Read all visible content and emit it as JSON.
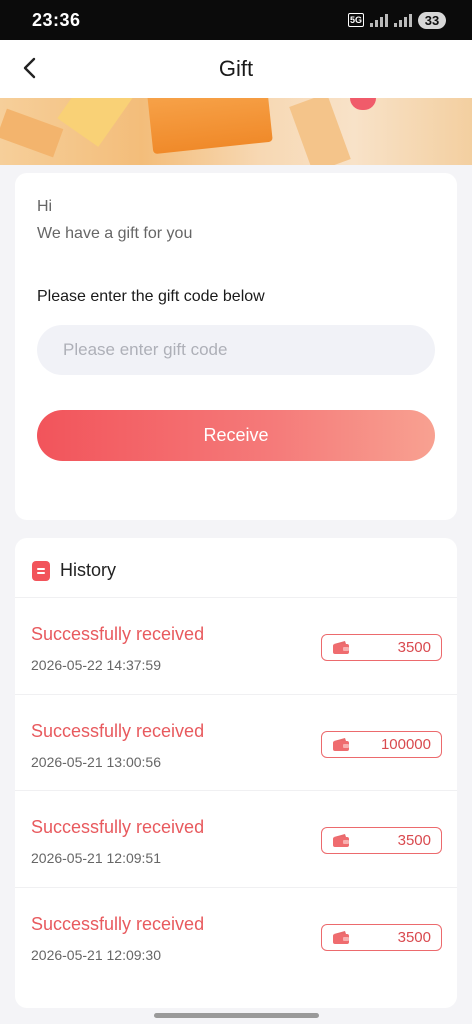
{
  "status_bar": {
    "time": "23:36",
    "network": "5G",
    "battery": "33"
  },
  "nav": {
    "back_icon": "chevron-left-icon",
    "title": "Gift"
  },
  "gift_card": {
    "greeting": "Hi",
    "sub_greeting": "We have a gift for you",
    "prompt": "Please enter the gift code below",
    "code_input": {
      "value": "",
      "placeholder": "Please enter gift code"
    },
    "receive_label": "Receive"
  },
  "history": {
    "icon": "list-icon",
    "title": "History",
    "items": [
      {
        "status": "Successfully received",
        "time": "2026-05-22 14:37:59",
        "amount": "3500",
        "icon": "wallet-icon"
      },
      {
        "status": "Successfully received",
        "time": "2026-05-21 13:00:56",
        "amount": "100000",
        "icon": "wallet-icon"
      },
      {
        "status": "Successfully received",
        "time": "2026-05-21 12:09:51",
        "amount": "3500",
        "icon": "wallet-icon"
      },
      {
        "status": "Successfully received",
        "time": "2026-05-21 12:09:30",
        "amount": "3500",
        "icon": "wallet-icon"
      }
    ]
  },
  "colors": {
    "accent": "#f2545b",
    "status_text": "#e85a5e",
    "background": "#f4f4f7"
  }
}
